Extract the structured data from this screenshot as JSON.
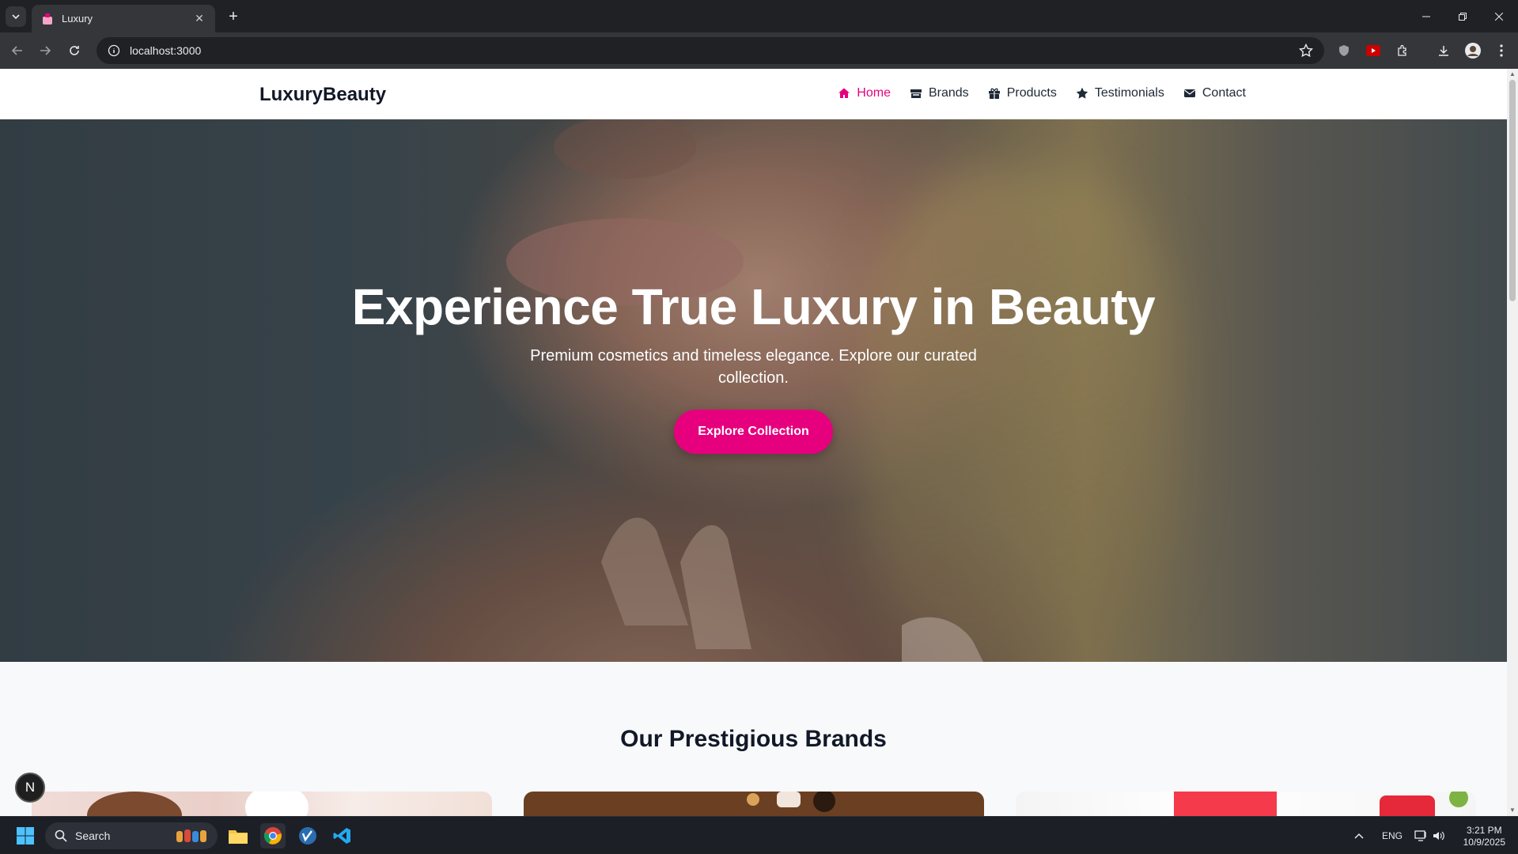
{
  "browser": {
    "tab_title": "Luxury",
    "url": "localhost:3000",
    "tab_close": "✕",
    "new_tab": "+"
  },
  "site": {
    "brand": "LuxuryBeauty",
    "nav": [
      {
        "label": "Home",
        "icon": "home-icon",
        "active": true
      },
      {
        "label": "Brands",
        "icon": "store-icon",
        "active": false
      },
      {
        "label": "Products",
        "icon": "gift-icon",
        "active": false
      },
      {
        "label": "Testimonials",
        "icon": "star-icon",
        "active": false
      },
      {
        "label": "Contact",
        "icon": "envelope-icon",
        "active": false
      }
    ],
    "hero": {
      "title": "Experience True Luxury in Beauty",
      "subtitle": "Premium cosmetics and timeless elegance. Explore our curated collection.",
      "cta": "Explore Collection"
    },
    "brands_title": "Our Prestigious Brands",
    "fab_letter": "N",
    "colors": {
      "accent": "#e6007e",
      "dark": "#111827"
    }
  },
  "taskbar": {
    "search_label": "Search",
    "lang": "ENG",
    "time": "3:21 PM",
    "date": "10/9/2025"
  }
}
